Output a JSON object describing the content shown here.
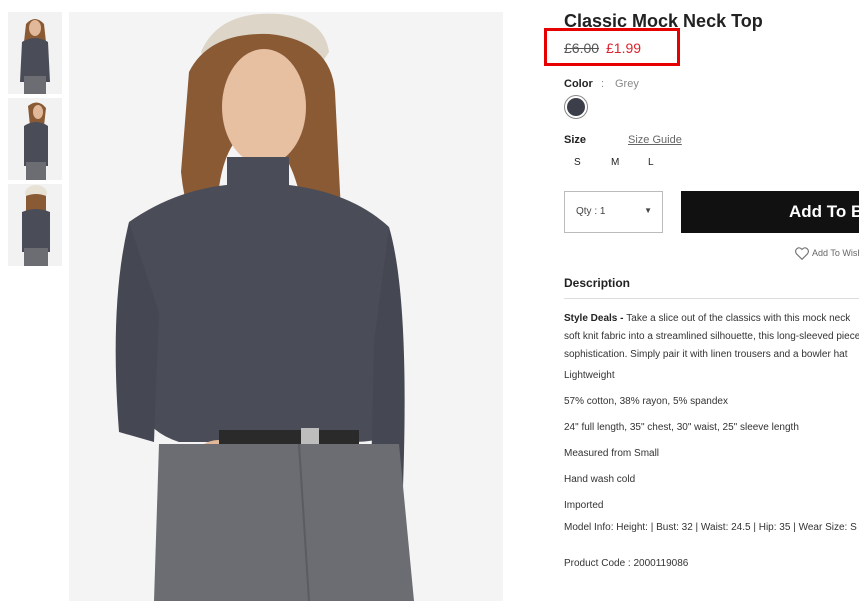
{
  "product": {
    "title": "Classic Mock Neck Top",
    "price_old": "£6.00",
    "price_new": "£1.99",
    "color_label": "Color",
    "color_separator": ":",
    "color_value": "Grey",
    "swatch_color": "#3c3f4a",
    "size_label": "Size",
    "size_guide": "Size Guide",
    "sizes": [
      "S",
      "M",
      "L"
    ],
    "qty_label": "Qty : 1",
    "add_button": "Add To Bag",
    "wishlist": "Add To Wishlist",
    "description_title": "Description",
    "desc_lead": "Style Deals - ",
    "desc_text": [
      "Take a slice out of the classics with this mock neck",
      "soft knit fabric into a streamlined silhouette, this long-sleeved piece",
      "sophistication. Simply pair it with linen trousers and a bowler hat"
    ],
    "details": [
      "Lightweight",
      "57% cotton, 38% rayon, 5% spandex",
      "24\" full length, 35\" chest, 30\" waist, 25\" sleeve length",
      "Measured from Small",
      "Hand wash cold",
      "Imported",
      "Model Info: Height: | Bust: 32 | Waist: 24.5 | Hip: 35 | Wear Size: S"
    ],
    "product_code": "Product Code : 2000119086"
  },
  "colors": {
    "highlight": "#e60000",
    "sale_price": "#d9232e",
    "button": "#111111"
  }
}
